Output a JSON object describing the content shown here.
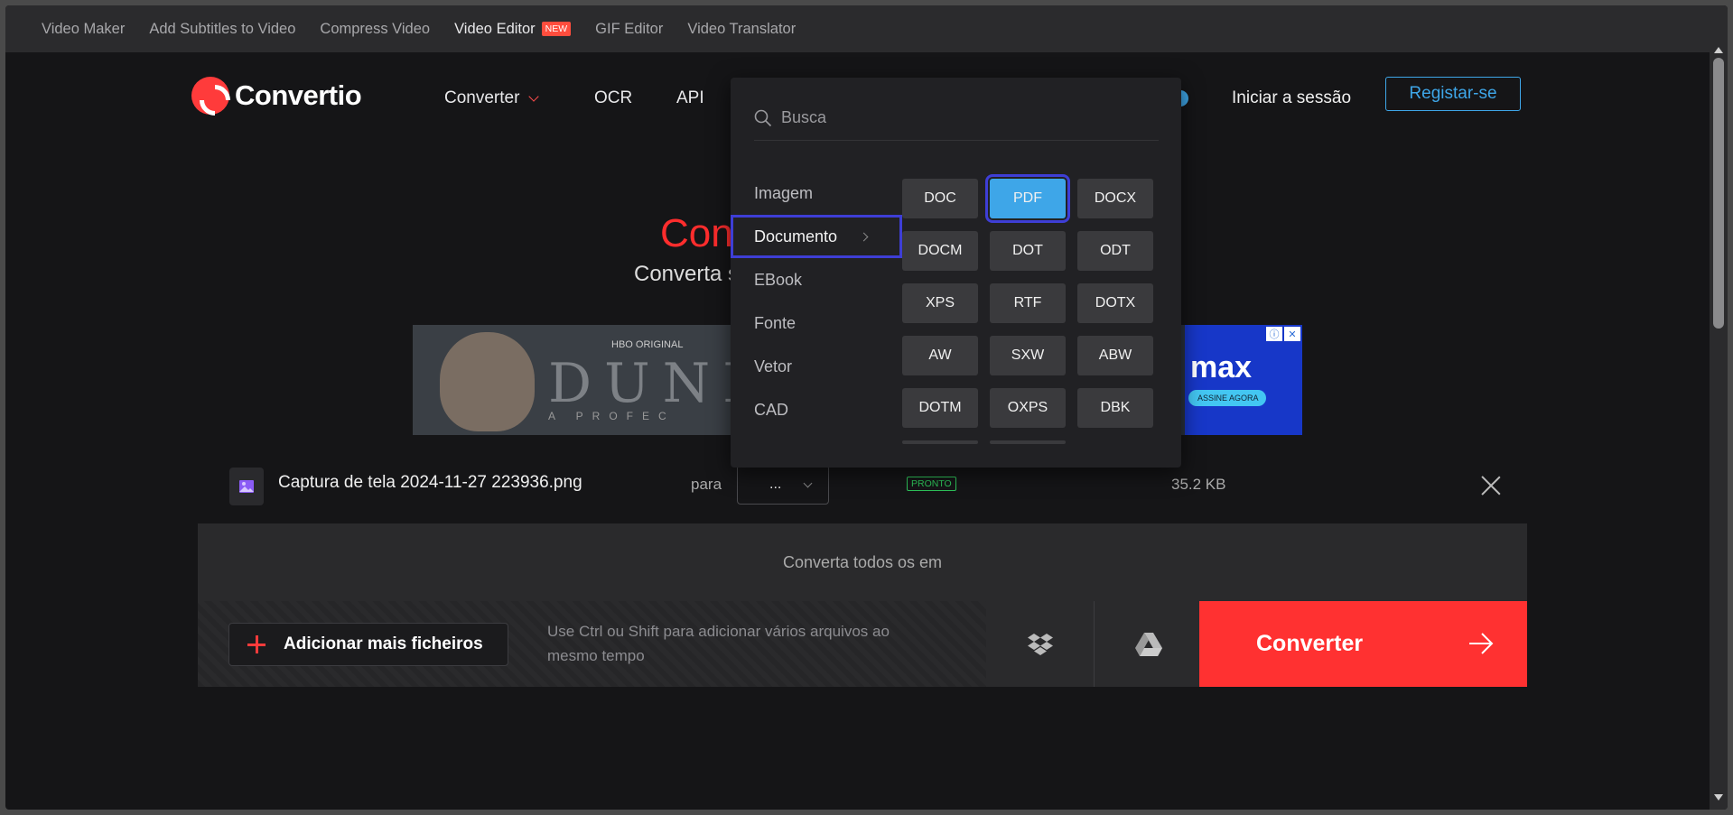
{
  "topbar": {
    "links": [
      "Video Maker",
      "Add Subtitles to Video",
      "Compress Video",
      "Video Editor",
      "GIF Editor",
      "Video Translator"
    ],
    "new_badge": "NEW"
  },
  "header": {
    "brand": "Convertio",
    "nav": {
      "converter": "Converter",
      "ocr": "OCR",
      "api": "API"
    },
    "signin": "Iniciar a sessão",
    "register": "Registar-se"
  },
  "hero": {
    "title_visible": "Con",
    "subtitle_visible": "Converta s"
  },
  "ad": {
    "hbo": "HBO ORIGINAL",
    "title": "DUNE",
    "subtitle": "A PROFEC",
    "brand": "max",
    "cta": "ASSINE AGORA"
  },
  "file": {
    "name": "Captura de tela 2024-11-27 223936.png",
    "to_label": "para",
    "format_value": "...",
    "status": "PRONTO",
    "size": "35.2 KB"
  },
  "convert_all": "Converta todos os em",
  "bottom": {
    "add_more": "Adicionar mais ficheiros",
    "hint": "Use Ctrl ou Shift para adicionar vários arquivos ao mesmo tempo",
    "convert": "Converter"
  },
  "dropdown": {
    "search_placeholder": "Busca",
    "categories": [
      "Imagem",
      "Documento",
      "EBook",
      "Fonte",
      "Vetor",
      "CAD"
    ],
    "active_category": "Documento",
    "formats": [
      "DOC",
      "PDF",
      "DOCX",
      "DOCM",
      "DOT",
      "ODT",
      "XPS",
      "RTF",
      "DOTX",
      "AW",
      "SXW",
      "ABW",
      "DOTM",
      "OXPS",
      "DBK"
    ],
    "selected_format": "PDF"
  },
  "colors": {
    "accent_red": "#ff3131",
    "accent_blue": "#3ea6e8",
    "highlight": "#3e3ed6",
    "ready_green": "#2ec45a"
  }
}
